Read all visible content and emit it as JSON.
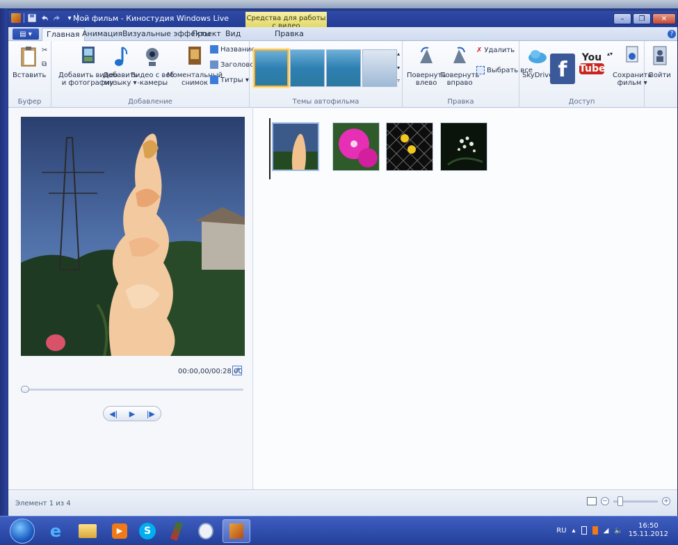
{
  "window": {
    "title": "Мой фильм - Киностудия Windows Live",
    "context_tab": "Средства для работы с видео"
  },
  "ribbon_tabs": {
    "file": "▤ ▾",
    "items": [
      "Главная",
      "Анимация",
      "Визуальные эффекты",
      "Проект",
      "Вид",
      "Правка"
    ],
    "active": "Главная"
  },
  "groups": {
    "clipboard": {
      "label": "Буфер",
      "paste": "Вставить"
    },
    "add": {
      "label": "Добавление",
      "add_video_line1": "Добавить видео",
      "add_video_line2": "и фотографии",
      "add_music_line1": "Добавить",
      "add_music_line2": "музыку ▾",
      "webcam_line1": "Видео с веб",
      "webcam_line2": "-камеры",
      "snapshot_line1": "Моментальный",
      "snapshot_line2": "снимок",
      "title": "Название",
      "caption": "Заголовок",
      "credits": "Титры ▾"
    },
    "themes": {
      "label": "Темы автофильма",
      "count": 4
    },
    "editing": {
      "label": "Правка",
      "rotate_left_line1": "Повернуть",
      "rotate_left_line2": "влево",
      "rotate_right_line1": "Повернуть",
      "rotate_right_line2": "вправо",
      "delete": "Удалить",
      "select_all": "Выбрать все"
    },
    "share": {
      "label": "Доступ",
      "skydrive": "SkyDrive",
      "youtube_top": "You",
      "youtube_bottom": "Tube",
      "save_movie_line1": "Сохранить",
      "save_movie_line2": "фильм ▾"
    },
    "signin": {
      "label": "Войти"
    }
  },
  "preview": {
    "timecode": "00:00,00/00:28,00",
    "seek_position": 0.0
  },
  "storyboard": {
    "clips": [
      {
        "name": "clip-1-gladiolus",
        "selected": true
      },
      {
        "name": "clip-2-pink-flower",
        "selected": false
      },
      {
        "name": "clip-3-yellow-fence",
        "selected": false
      },
      {
        "name": "clip-4-white-flowers",
        "selected": false
      }
    ]
  },
  "status": {
    "text": "Элемент 1 из 4"
  },
  "taskbar": {
    "lang": "RU",
    "time": "16:50",
    "date": "15.11.2012"
  },
  "colors": {
    "titlebar": "#233d96",
    "context_tab": "#e3d86a",
    "accent": "#2b62c6",
    "selection": "#f0b23a"
  }
}
